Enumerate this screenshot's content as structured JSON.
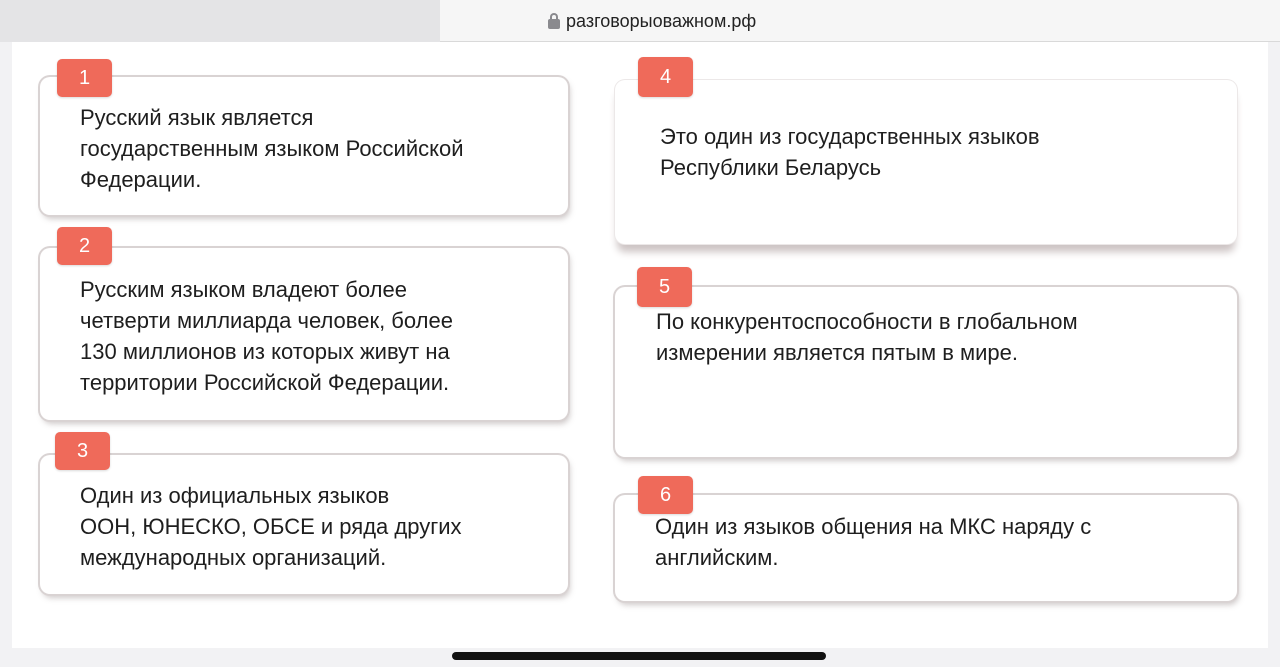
{
  "browser": {
    "url": "разговорыоважном.рф"
  },
  "cards": [
    {
      "number": "1",
      "lines": [
        "Русский язык является",
        "государственным языком Российской",
        "Федерации."
      ]
    },
    {
      "number": "2",
      "lines": [
        "Русским языком владеют более",
        "четверти миллиарда человек, более",
        "130 миллионов из которых живут на",
        "территории Российской Федерации."
      ]
    },
    {
      "number": "3",
      "lines": [
        "Один из официальных языков",
        "ООН, ЮНЕСКО, ОБСЕ и ряда других",
        "международных организаций."
      ]
    },
    {
      "number": "4",
      "lines": [
        "Это один из государственных языков",
        "Республики Беларусь"
      ]
    },
    {
      "number": "5",
      "lines": [
        "По конкурентоспособности в глобальном",
        "измерении является пятым в мире."
      ]
    },
    {
      "number": "6",
      "lines": [
        "Один из языков общения на МКС наряду с",
        "английским."
      ]
    }
  ],
  "colors": {
    "badge": "#ef6a5a",
    "card_border": "#d9d3d3"
  },
  "icons": {
    "address_bar": "lock-icon"
  }
}
